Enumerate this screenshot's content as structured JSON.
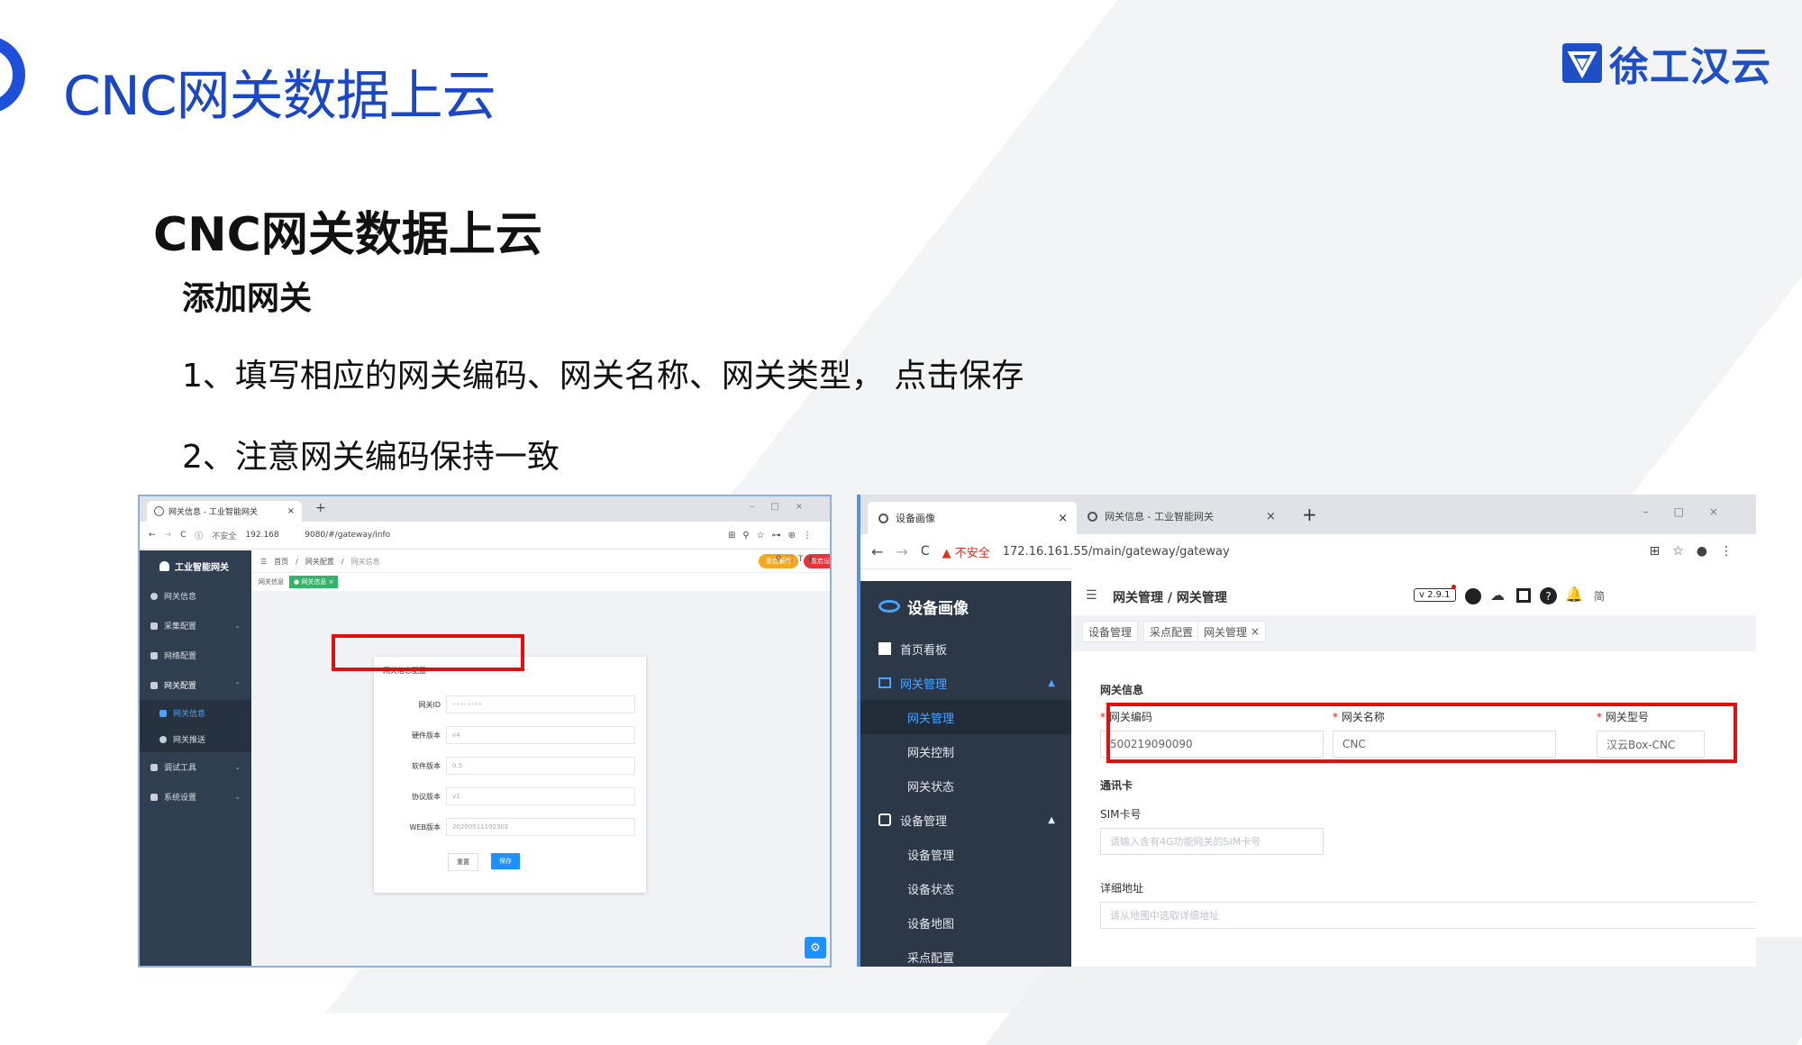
{
  "slide": {
    "title": "CNC网关数据上云",
    "heading": "CNC网关数据上云",
    "subheading": "添加网关",
    "steps": [
      "1、填写相应的网关编码、网关名称、网关类型， 点击保存",
      "2、注意网关编码保持一致"
    ],
    "logo_text": "徐工汉云",
    "accent_color": "#1a48c4"
  },
  "left_shot": {
    "tab_title": "网关信息 - 工业智能网关",
    "address_warning": "不安全",
    "address_url": "192.168          9080/#/gateway/info",
    "brand": "工业智能网关",
    "sidebar": [
      {
        "label": "网关信息",
        "icon": "info-icon"
      },
      {
        "label": "采集配置",
        "icon": "cloud-icon"
      },
      {
        "label": "网络配置",
        "icon": "send-icon"
      },
      {
        "label": "网关配置",
        "icon": "lock-icon"
      },
      {
        "label": "网关信息",
        "icon": "grid-icon",
        "active": true
      },
      {
        "label": "网关推送",
        "icon": "clock-icon"
      },
      {
        "label": "调试工具",
        "icon": "home-icon"
      },
      {
        "label": "系统设置",
        "icon": "menu-icon"
      }
    ],
    "breadcrumb": [
      "首页",
      "网关配置",
      "网关信息"
    ],
    "restart_service": "重启服务",
    "restart_device": "重启设备",
    "page_tabs": [
      "网关信息",
      "网关信息"
    ],
    "card_title": "网关信息配置",
    "fields": [
      {
        "label": "网关ID",
        "value": "••••••••"
      },
      {
        "label": "硬件版本",
        "value": "v4"
      },
      {
        "label": "软件版本",
        "value": "0.5"
      },
      {
        "label": "协议版本",
        "value": "v1"
      },
      {
        "label": "WEB版本",
        "value": "20200511102302"
      }
    ],
    "reset_button": "重置",
    "save_button": "保存"
  },
  "right_shot": {
    "tabs": [
      "设备画像",
      "网关信息 - 工业智能网关"
    ],
    "address_warning": "不安全",
    "address_url": "172.16.161.55/main/gateway/gateway",
    "brand": "设备画像",
    "sidebar": [
      {
        "label": "首页看板",
        "type": "item"
      },
      {
        "label": "网关管理",
        "type": "item",
        "active": true
      },
      {
        "label": "网关管理",
        "type": "sub",
        "active": true
      },
      {
        "label": "网关控制",
        "type": "sub"
      },
      {
        "label": "网关状态",
        "type": "sub"
      },
      {
        "label": "设备管理",
        "type": "item"
      },
      {
        "label": "设备管理",
        "type": "sub"
      },
      {
        "label": "设备状态",
        "type": "sub"
      },
      {
        "label": "设备地图",
        "type": "sub"
      },
      {
        "label": "采点配置",
        "type": "sub"
      }
    ],
    "breadcrumb": "网关管理 / 网关管理",
    "version": "v 2.9.1",
    "lang": "简",
    "page_tabs": [
      "设备管理",
      "采点配置",
      "网关管理"
    ],
    "section_title": "网关信息",
    "code_label": "网关编码",
    "code_value": "500219090090",
    "name_label": "网关名称",
    "name_value": "CNC",
    "type_label": "网关型号",
    "type_value": "汉云Box-CNC",
    "sim_section": "通讯卡",
    "sim_label": "SIM卡号",
    "sim_placeholder": "请输入含有4G功能网关的SIM卡号",
    "addr_label": "详细地址",
    "addr_placeholder": "请从地图中选取详细地址"
  }
}
